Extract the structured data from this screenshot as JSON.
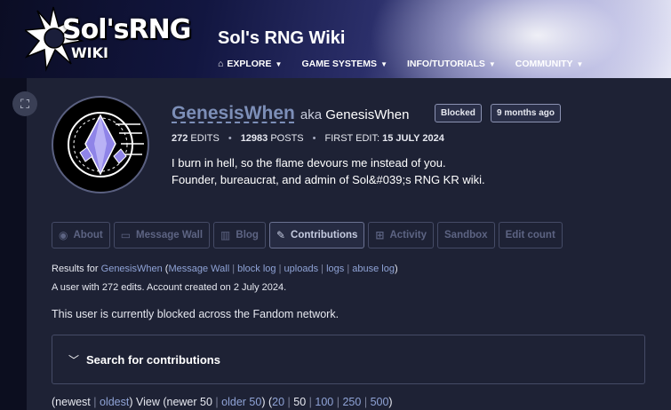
{
  "header": {
    "logo_text": "Sol'sRNG",
    "logo_sub": "WIKI",
    "site_title": "Sol's RNG Wiki",
    "nav": [
      {
        "label": "EXPLORE",
        "icon": "explore-icon"
      },
      {
        "label": "GAME SYSTEMS"
      },
      {
        "label": "INFO/TUTORIALS"
      },
      {
        "label": "COMMUNITY"
      }
    ]
  },
  "profile": {
    "username": "GenesisWhen",
    "aka_label": "aka",
    "aka_name": "GenesisWhen",
    "badges": {
      "blocked": "Blocked",
      "ago": "9 months ago"
    },
    "stats": {
      "edits_value": "272",
      "edits_label": "EDITS",
      "posts_value": "12983",
      "posts_label": "POSTS",
      "first_edit_label": "FIRST EDIT:",
      "first_edit_value": "15 JULY 2024"
    },
    "bio_line1": "I burn in hell, so the flame devours me instead of you.",
    "bio_line2": "Founder, bureaucrat, and admin of Sol&#039;s RNG KR wiki."
  },
  "tabs": [
    {
      "label": "About",
      "icon": "user-icon"
    },
    {
      "label": "Message Wall",
      "icon": "message-icon"
    },
    {
      "label": "Blog",
      "icon": "book-icon"
    },
    {
      "label": "Contributions",
      "icon": "pencil-icon",
      "active": true
    },
    {
      "label": "Activity",
      "icon": "grid-icon"
    },
    {
      "label": "Sandbox"
    },
    {
      "label": "Edit count"
    }
  ],
  "results": {
    "prefix": "Results for",
    "user_link": "GenesisWhen",
    "links": [
      "Message Wall",
      "block log",
      "uploads",
      "logs",
      "abuse log"
    ]
  },
  "created_text": "A user with 272 edits. Account created on 2 July 2024.",
  "blocked_text": "This user is currently blocked across the Fandom network.",
  "search_label": "Search for contributions",
  "pager": {
    "newest": "newest",
    "oldest": "oldest",
    "view": "View (newer 50",
    "older": "older 50",
    "n20": "20",
    "n50": "50",
    "n100": "100",
    "n250": "250",
    "n500": "500"
  }
}
